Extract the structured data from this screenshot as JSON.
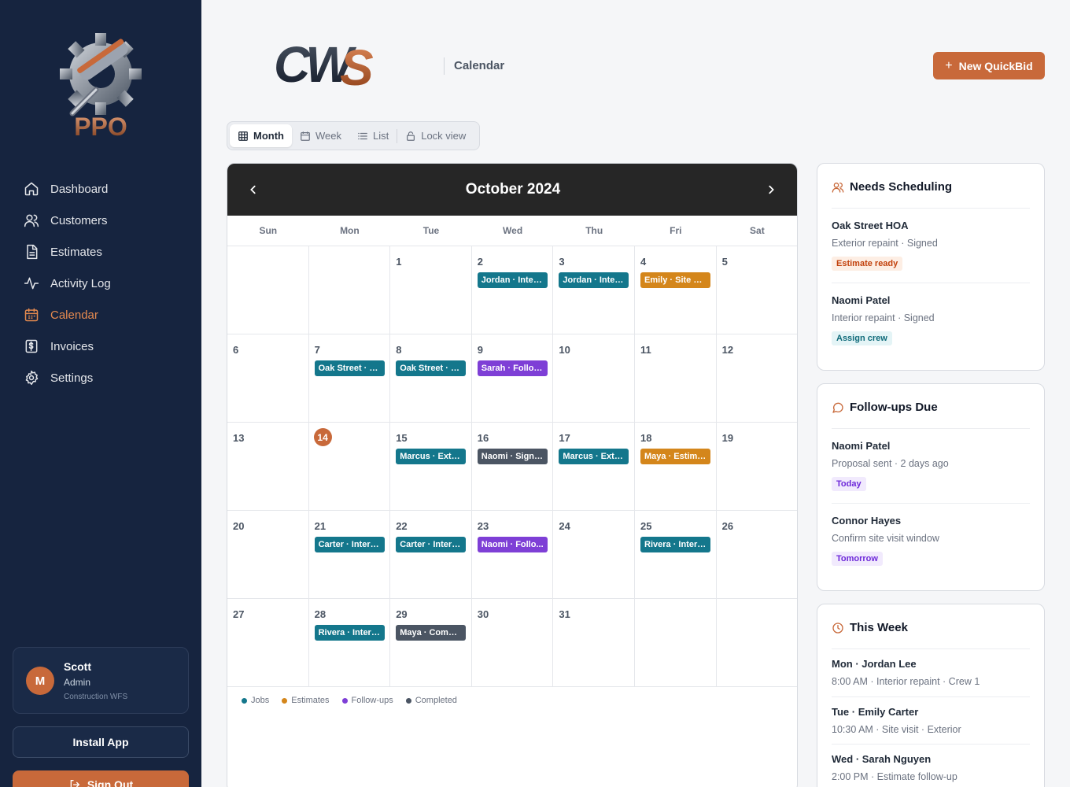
{
  "colors": {
    "sidebar_bg": "#16243f",
    "accent": "#c8693a",
    "jobs": "#14778c",
    "estimates": "#d4861b",
    "followups": "#7e3fd6",
    "completed": "#4b5563"
  },
  "brand": {
    "logo_text": "PPO",
    "wordmark": "CWS"
  },
  "sidebar": {
    "items": [
      {
        "label": "Dashboard",
        "icon": "home-icon"
      },
      {
        "label": "Customers",
        "icon": "users-icon"
      },
      {
        "label": "Estimates",
        "icon": "document-icon"
      },
      {
        "label": "Activity Log",
        "icon": "activity-icon"
      },
      {
        "label": "Calendar",
        "icon": "calendar-icon",
        "active": true
      },
      {
        "label": "Invoices",
        "icon": "invoice-icon"
      },
      {
        "label": "Settings",
        "icon": "gear-icon"
      }
    ],
    "user": {
      "initial": "M",
      "name": "Scott",
      "role": "Admin",
      "org": "Construction WFS"
    },
    "install_label": "Install App",
    "signout_label": "Sign Out"
  },
  "header": {
    "title": "Calendar",
    "new_button": "New QuickBid"
  },
  "views": {
    "month": "Month",
    "week": "Week",
    "list": "List",
    "lock": "Lock view",
    "active": "Month"
  },
  "calendar": {
    "title": "October 2024",
    "weekdays": [
      "Sun",
      "Mon",
      "Tue",
      "Wed",
      "Thu",
      "Fri",
      "Sat"
    ],
    "today": 14,
    "weeks": [
      [
        {
          "day": ""
        },
        {
          "day": ""
        },
        {
          "day": "1"
        },
        {
          "day": "2",
          "event": {
            "label": "Jordan · Interior",
            "type": "jobs"
          }
        },
        {
          "day": "3",
          "event": {
            "label": "Jordan · Interior",
            "type": "jobs"
          }
        },
        {
          "day": "4",
          "event": {
            "label": "Emily · Site visit",
            "type": "estimates"
          }
        },
        {
          "day": "5"
        }
      ],
      [
        {
          "day": "6"
        },
        {
          "day": "7",
          "event": {
            "label": "Oak Street · E...",
            "type": "jobs"
          }
        },
        {
          "day": "8",
          "event": {
            "label": "Oak Street · E...",
            "type": "jobs"
          }
        },
        {
          "day": "9",
          "event": {
            "label": "Sarah · Follow...",
            "type": "followups"
          }
        },
        {
          "day": "10"
        },
        {
          "day": "11"
        },
        {
          "day": "12"
        }
      ],
      [
        {
          "day": "13"
        },
        {
          "day": "14"
        },
        {
          "day": "15",
          "event": {
            "label": "Marcus · Exte...",
            "type": "jobs"
          }
        },
        {
          "day": "16",
          "event": {
            "label": "Naomi · Signed",
            "type": "completed"
          }
        },
        {
          "day": "17",
          "event": {
            "label": "Marcus · Exte...",
            "type": "jobs"
          }
        },
        {
          "day": "18",
          "event": {
            "label": "Maya · Estimate",
            "type": "estimates"
          }
        },
        {
          "day": "19"
        }
      ],
      [
        {
          "day": "20"
        },
        {
          "day": "21",
          "event": {
            "label": "Carter · Interior",
            "type": "jobs"
          }
        },
        {
          "day": "22",
          "event": {
            "label": "Carter · Interior",
            "type": "jobs"
          }
        },
        {
          "day": "23",
          "event": {
            "label": "Naomi · Follo...",
            "type": "followups"
          }
        },
        {
          "day": "24"
        },
        {
          "day": "25",
          "event": {
            "label": "Rivera · Interior",
            "type": "jobs"
          }
        },
        {
          "day": "26"
        }
      ],
      [
        {
          "day": "27"
        },
        {
          "day": "28",
          "event": {
            "label": "Rivera · Interior",
            "type": "jobs"
          }
        },
        {
          "day": "29",
          "event": {
            "label": "Maya · Compl...",
            "type": "completed"
          }
        },
        {
          "day": "30"
        },
        {
          "day": "31"
        },
        {
          "day": ""
        },
        {
          "day": ""
        }
      ]
    ],
    "legend": [
      {
        "label": "Jobs",
        "type": "jobs"
      },
      {
        "label": "Estimates",
        "type": "estimates"
      },
      {
        "label": "Follow-ups",
        "type": "followups"
      },
      {
        "label": "Completed",
        "type": "completed"
      }
    ]
  },
  "panels": {
    "needs_scheduling": {
      "title": "Needs Scheduling",
      "items": [
        {
          "name": "Oak Street HOA",
          "sub": "Exterior repaint · Signed",
          "tag": "Estimate ready"
        },
        {
          "name": "Naomi Patel",
          "sub": "Interior repaint · Signed",
          "tag": "Assign crew"
        }
      ]
    },
    "followups_due": {
      "title": "Follow-ups Due",
      "items": [
        {
          "name": "Naomi Patel",
          "sub": "Proposal sent · 2 days ago",
          "tag": "Today"
        },
        {
          "name": "Connor Hayes",
          "sub": "Confirm site visit window",
          "tag": "Tomorrow"
        }
      ]
    },
    "this_week": {
      "title": "This Week",
      "items": [
        {
          "name": "Mon · Jordan Lee",
          "sub": "8:00 AM · Interior repaint · Crew 1"
        },
        {
          "name": "Tue · Emily Carter",
          "sub": "10:30 AM · Site visit · Exterior"
        },
        {
          "name": "Wed · Sarah Nguyen",
          "sub": "2:00 PM · Estimate follow-up"
        }
      ]
    }
  }
}
